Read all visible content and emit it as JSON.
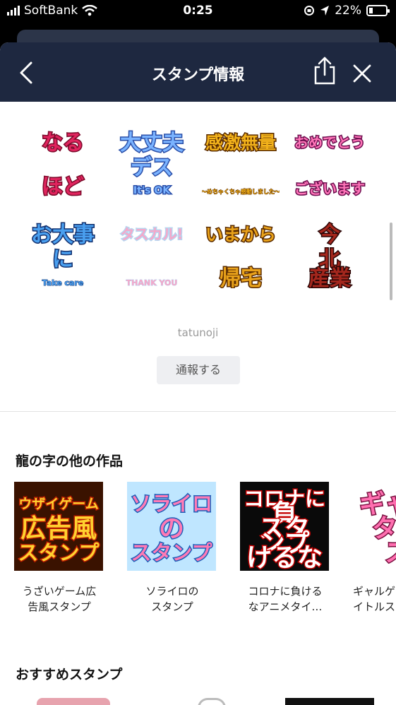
{
  "status_bar": {
    "carrier": "SoftBank",
    "time": "0:25",
    "battery": "22%",
    "battery_level": 0.22
  },
  "header": {
    "title": "スタンプ情報"
  },
  "stickers": [
    {
      "name": "naruhodo",
      "lines": [
        "なる",
        "ほど"
      ],
      "fill": "#e0245e",
      "stroke": "#7a0a2a"
    },
    {
      "name": "daijoubu",
      "lines": [
        "大丈夫",
        "デス",
        "It's OK"
      ],
      "fill": "#7ab3ff",
      "stroke": "#2b4fa8"
    },
    {
      "name": "kangeki",
      "lines": [
        "感激無量",
        "〜めちゃくちゃ感動しました〜"
      ],
      "fill": "#f2b21b",
      "stroke": "#5a2b00"
    },
    {
      "name": "omedetou",
      "lines": [
        "おめでとう",
        "ございます"
      ],
      "fill": "#ff74b8",
      "stroke": "#6e1050"
    },
    {
      "name": "odaijini",
      "lines": [
        "お大事",
        "に",
        "Take care"
      ],
      "fill": "#4aa0f0",
      "stroke": "#12306e"
    },
    {
      "name": "tasukaru",
      "lines": [
        "タスカル!",
        "THANK YOU"
      ],
      "fill": "#f6a7c9",
      "stroke": "#b7d6f0"
    },
    {
      "name": "imakara-kitaku",
      "lines": [
        "いまから",
        "帰宅"
      ],
      "fill": "#e9a21b",
      "stroke": "#5a2b00"
    },
    {
      "name": "zangyou",
      "lines": [
        "今",
        "北",
        "産業"
      ],
      "fill": "#a4271d",
      "stroke": "#2a0505"
    }
  ],
  "author": "tatunoji",
  "report_label": "通報する",
  "other_works": {
    "title": "龍の字の他の作品",
    "items": [
      {
        "name": "うざいゲーム広\n告風スタンプ",
        "thumb": [
          "ウザイゲーム",
          "広告風",
          "スタンプ"
        ]
      },
      {
        "name": "ソライロの\nスタンプ",
        "thumb": [
          "ソライロ",
          "の",
          "スタンプ"
        ]
      },
      {
        "name": "コロナに負ける\nなアニメタイ…",
        "thumb": [
          "コロナに",
          "負",
          "スタ",
          "ンプ",
          "けるな"
        ]
      },
      {
        "name": "ギャルゲ\nイトルス",
        "thumb": [
          "ギャル",
          "タイ",
          "ス"
        ]
      }
    ]
  },
  "recommended": {
    "title": "おすすめスタンプ"
  },
  "colors": {
    "navbar": "#1e2840",
    "background": "#ffffff"
  },
  "icons": {
    "back": "chevron-left-icon",
    "share": "share-icon",
    "close": "close-icon"
  }
}
